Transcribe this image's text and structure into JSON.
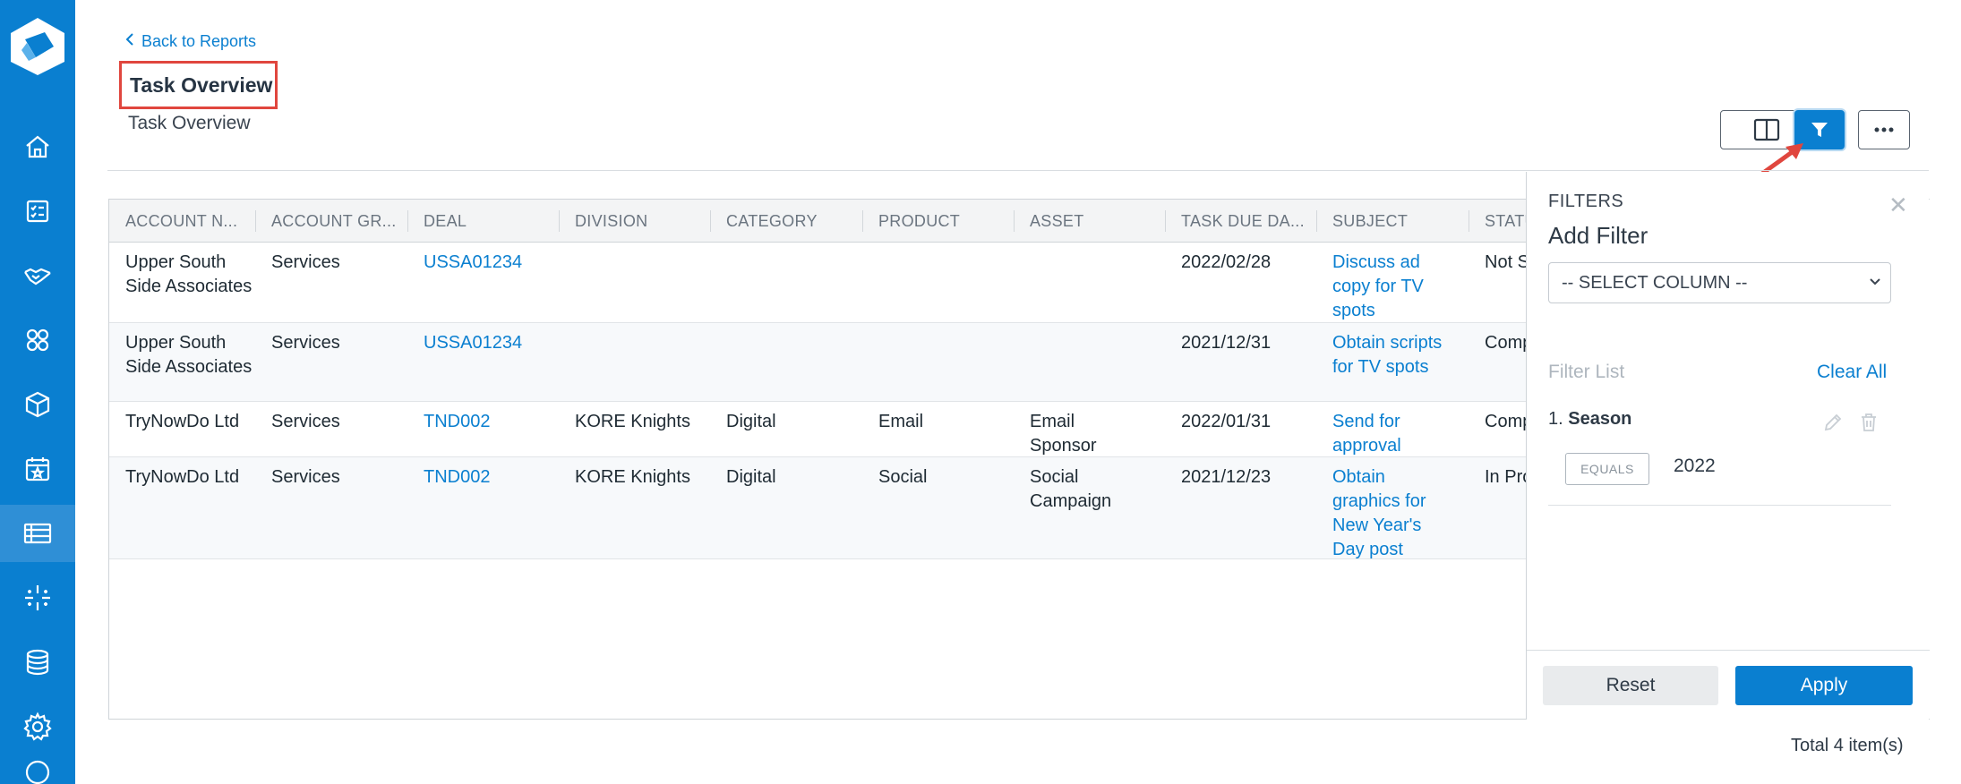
{
  "sidebar": {
    "items": [
      {
        "icon": "home-icon"
      },
      {
        "icon": "tasks-icon"
      },
      {
        "icon": "handshake-icon"
      },
      {
        "icon": "accounts-icon"
      },
      {
        "icon": "box-icon"
      },
      {
        "icon": "calendar-icon"
      },
      {
        "icon": "reports-icon",
        "active": true
      },
      {
        "icon": "sparkle-icon"
      },
      {
        "icon": "database-icon"
      },
      {
        "icon": "gear-icon"
      }
    ]
  },
  "header": {
    "back_label": "Back to Reports",
    "title": "Task Overview",
    "subtitle": "Task Overview"
  },
  "toolbar": {
    "columns_icon": "columns-icon",
    "filter_icon": "filter-icon",
    "more_icon": "more-icon"
  },
  "table": {
    "columns": [
      "ACCOUNT N...",
      "ACCOUNT GR...",
      "DEAL",
      "DIVISION",
      "CATEGORY",
      "PRODUCT",
      "ASSET",
      "TASK DUE DA...",
      "SUBJECT",
      "STATUS"
    ],
    "rows": [
      {
        "account": "Upper South Side Associates",
        "group": "Services",
        "deal": "USSA01234",
        "division": "",
        "category": "",
        "product": "",
        "asset": "",
        "due": "2022/02/28",
        "subject": "Discuss ad copy for TV spots",
        "status": "Not Started"
      },
      {
        "account": "Upper South Side Associates",
        "group": "Services",
        "deal": "USSA01234",
        "division": "",
        "category": "",
        "product": "",
        "asset": "",
        "due": "2021/12/31",
        "subject": "Obtain scripts for TV spots",
        "status": "Completed"
      },
      {
        "account": "TryNowDo Ltd",
        "group": "Services",
        "deal": "TND002",
        "division": "KORE Knights",
        "category": "Digital",
        "product": "Email",
        "asset": "Email Sponsor",
        "due": "2022/01/31",
        "subject": "Send for approval",
        "status": "Completed"
      },
      {
        "account": "TryNowDo Ltd",
        "group": "Services",
        "deal": "TND002",
        "division": "KORE Knights",
        "category": "Digital",
        "product": "Social",
        "asset": "Social Campaign",
        "due": "2021/12/23",
        "subject": "Obtain graphics for New Year's Day post",
        "status": "In Progress"
      }
    ]
  },
  "filters": {
    "label": "FILTERS",
    "add_filter": "Add Filter",
    "select_placeholder": "-- SELECT COLUMN --",
    "list_label": "Filter List",
    "clear_all": "Clear All",
    "items": [
      {
        "index": "1.",
        "name": "Season",
        "operator": "EQUALS",
        "value": "2022"
      }
    ],
    "reset_label": "Reset",
    "apply_label": "Apply"
  },
  "footer": {
    "total": "Total 4 item(s)"
  },
  "colors": {
    "primary": "#0a7fd0",
    "highlight_border": "#e0463e"
  }
}
